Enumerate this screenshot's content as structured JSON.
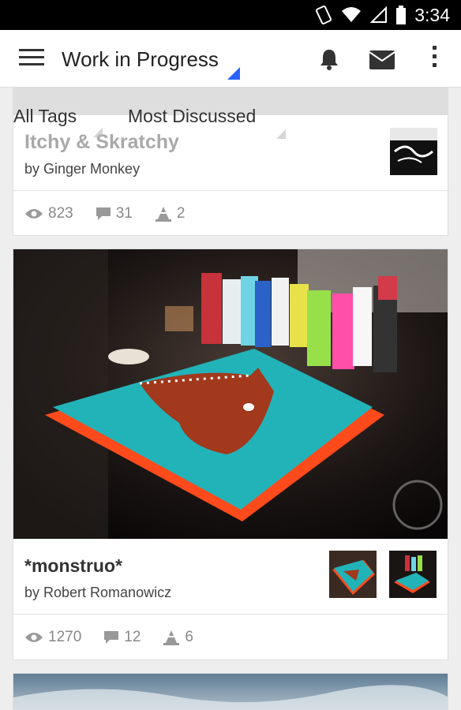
{
  "status": {
    "time": "3:34"
  },
  "header": {
    "title": "Work in Progress"
  },
  "filters": {
    "tag": "All Tags",
    "sort": "Most Discussed"
  },
  "cards": [
    {
      "title": "Itchy & Skratchy",
      "author": "by Ginger Monkey",
      "views": "823",
      "comments": "31",
      "likes": "2"
    },
    {
      "title": "*monstruo*",
      "author": "by Robert Romanowicz",
      "views": "1270",
      "comments": "12",
      "likes": "6"
    }
  ],
  "colors": {
    "accent": "#2962ff",
    "canvas_teal": "#22b3b8",
    "canvas_orange": "#ff4a1c"
  }
}
